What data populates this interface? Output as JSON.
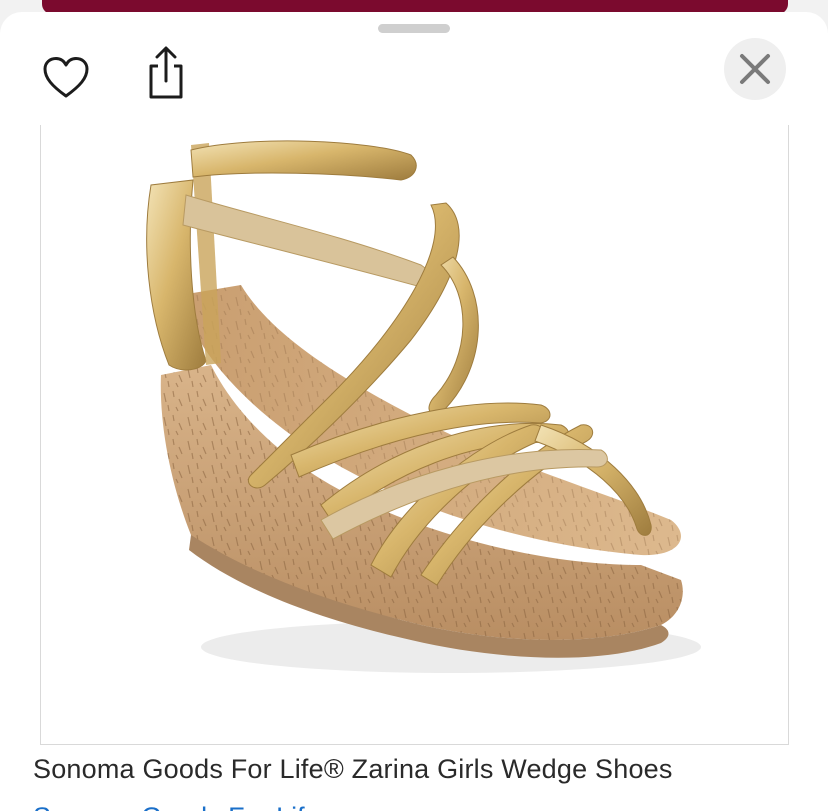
{
  "backdrop": {
    "accent_color": "#7b0a2e"
  },
  "toolbar": {
    "favorite_icon": "heart-outline-icon",
    "share_icon": "share-icon",
    "close_icon": "close-x-icon"
  },
  "product": {
    "image_alt": "Sonoma Goods For Life Zarina Girls Wedge Shoes - gold strappy cork wedge sandal",
    "title": "Sonoma Goods For Life® Zarina Girls Wedge Shoes",
    "brand_link": "Sonoma Goods For Life"
  },
  "colors": {
    "link": "#1a6fc9",
    "gold": "#d6b56a",
    "cork": "#c9a27a"
  }
}
